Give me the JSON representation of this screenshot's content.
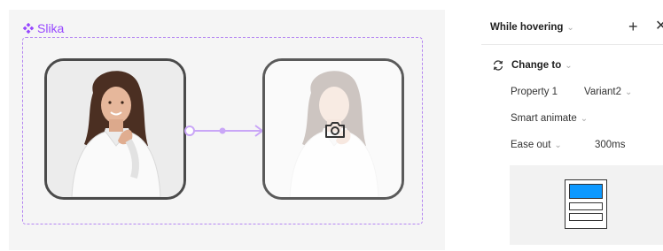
{
  "canvas": {
    "component_name": "Slika",
    "accent_color": "#9747ff",
    "frame_icon": "component-diamond-icon",
    "card_placeholder_icon": "camera-icon"
  },
  "panel": {
    "trigger": "While hovering",
    "add_icon": "plus-icon",
    "close_icon": "close-icon",
    "action": "Change to",
    "action_icon": "swap-arrows-icon",
    "property_label": "Property 1",
    "property_value": "Variant2",
    "animation": "Smart animate",
    "easing": "Ease out",
    "duration": "300ms",
    "preview_accent": "#0d99ff"
  }
}
